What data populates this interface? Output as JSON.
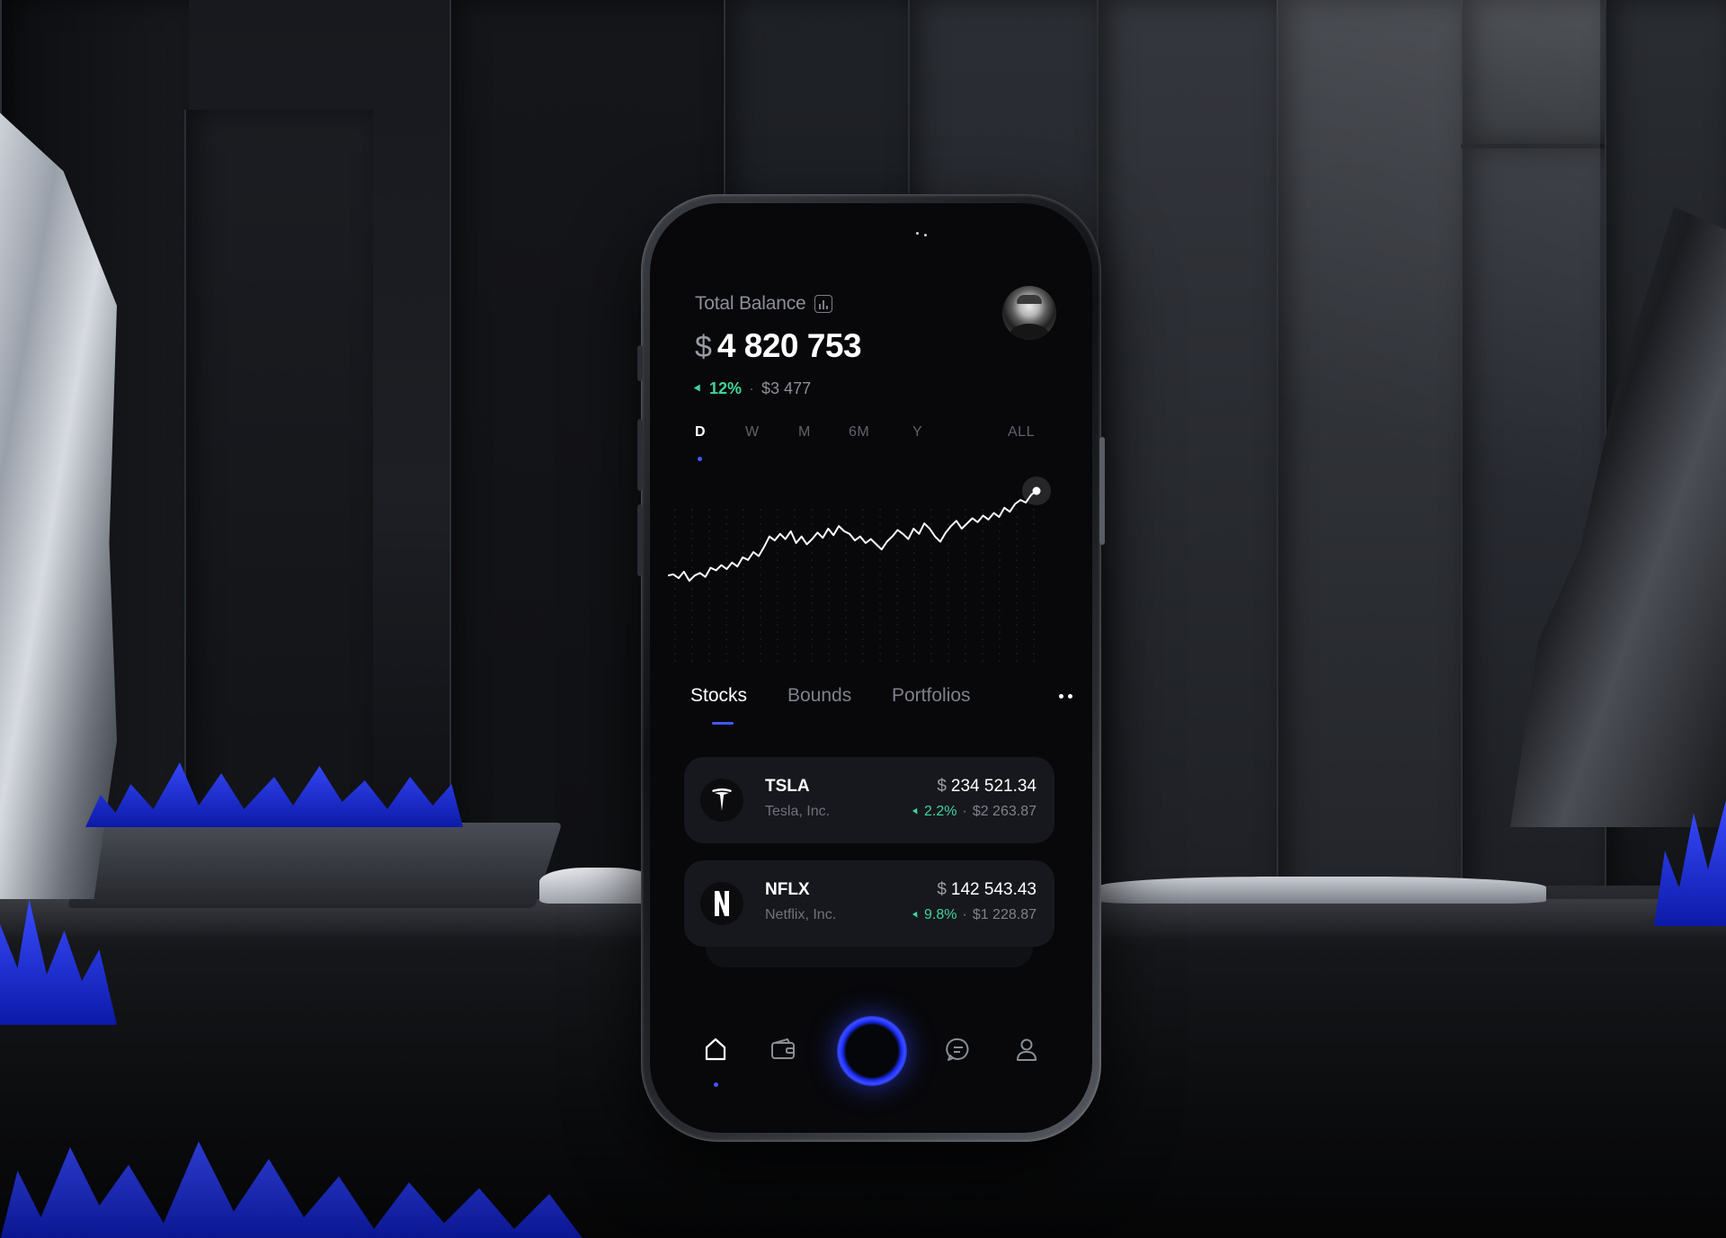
{
  "app": {
    "balance_label": "Total Balance",
    "currency_symbol": "$",
    "balance_amount": "4 820 753",
    "change_percent": "12%",
    "change_separator": "·",
    "change_amount": "$3 477"
  },
  "periods": [
    "D",
    "W",
    "M",
    "6M",
    "Y",
    "ALL"
  ],
  "selected_period": "D",
  "chart_data": {
    "type": "line",
    "values": [
      30,
      31,
      28,
      33,
      26,
      30,
      32,
      29,
      36,
      34,
      38,
      35,
      40,
      37,
      44,
      42,
      48,
      45,
      52,
      60,
      57,
      62,
      58,
      64,
      55,
      60,
      54,
      58,
      63,
      59,
      66,
      61,
      68,
      64,
      62,
      57,
      60,
      55,
      58,
      54,
      50,
      56,
      60,
      65,
      62,
      58,
      66,
      62,
      70,
      66,
      60,
      56,
      63,
      68,
      72,
      66,
      70,
      74,
      71,
      76,
      73,
      78,
      75,
      82,
      79,
      85,
      88,
      86,
      92,
      95
    ],
    "accent_color": "#4457ff"
  },
  "tabs": [
    "Stocks",
    "Bounds",
    "Portfolios"
  ],
  "selected_tab": "Stocks",
  "stocks": [
    {
      "ticker": "TSLA",
      "name": "Tesla, Inc.",
      "currency": "$",
      "price": "234 521.34",
      "change_percent": "2.2%",
      "separator": "·",
      "change_amount": "$2 263.87",
      "logo_icon": "tesla-logo-icon"
    },
    {
      "ticker": "NFLX",
      "name": "Netflix, Inc.",
      "currency": "$",
      "price": "142 543.43",
      "change_percent": "9.8%",
      "separator": "·",
      "change_amount": "$1 228.87",
      "logo_icon": "netflix-logo-icon"
    }
  ],
  "nav": {
    "items": [
      "home-icon",
      "wallet-icon",
      "center-action-button",
      "chat-icon",
      "profile-icon"
    ],
    "active": "home-icon"
  },
  "colors": {
    "positive": "#42d49a",
    "accent": "#4457ff",
    "card_bg": "#17181d",
    "screen_bg": "#08080b"
  }
}
